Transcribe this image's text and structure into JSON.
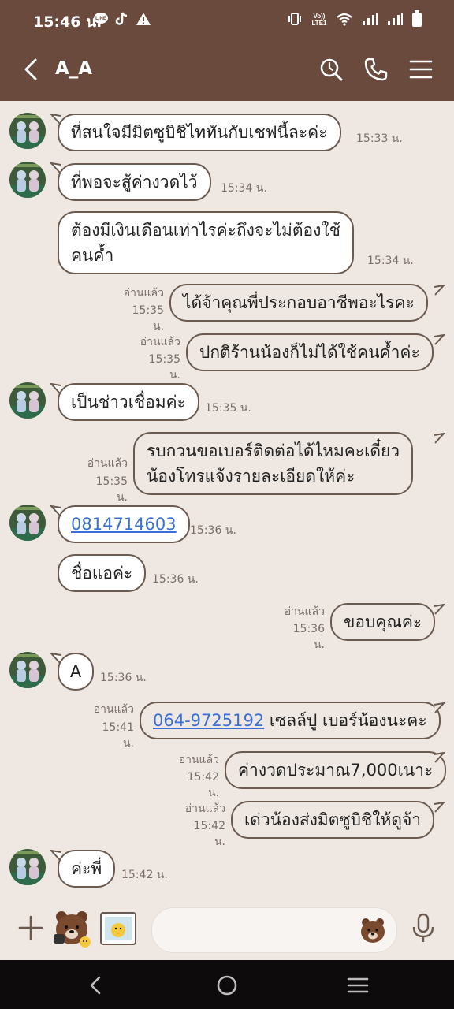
{
  "status_bar": {
    "time": "15:46 น.",
    "icons": [
      "line-notification-icon",
      "tiktok-icon",
      "warning-icon",
      "vibrate-icon",
      "volte-icon",
      "wifi-icon",
      "signal-icon",
      "signal-icon",
      "battery-icon"
    ]
  },
  "header": {
    "title": "A_A",
    "icons": [
      "back-icon",
      "search-icon",
      "phone-icon",
      "menu-icon"
    ]
  },
  "messages": [
    {
      "side": "in",
      "text": "ที่สนใจมีมิตซูบิชิไททันกับเชฟนี้ละค่ะ",
      "time": "15:33 น."
    },
    {
      "side": "in",
      "text": "ที่พอจะสู้ค่างวดไว้",
      "time": "15:34 น."
    },
    {
      "side": "in",
      "text": "ต้องมีเงินเดือนเท่าไรค่ะถึงจะไม่ต้องใช้คนค้ำ",
      "lines": [
        "ต้องมีเงินเดือนเท่าไรค่ะถึงจะไม่ต้องใช้",
        "คนค้ำ"
      ],
      "time": "15:34 น."
    },
    {
      "side": "out",
      "text": "ได้จ้าคุณพี่ประกอบอาชีพอะไรคะ",
      "read": "อ่านแล้ว",
      "time": "15:35 น."
    },
    {
      "side": "out",
      "text": "ปกติร้านน้องก็ไม่ได้ใช้คนค้ำค่ะ",
      "read": "อ่านแล้ว",
      "time": "15:35 น."
    },
    {
      "side": "in",
      "text": "เป็นช่าวเชื่อมค่ะ",
      "time": "15:35 น."
    },
    {
      "side": "out",
      "text": "รบกวนขอเบอร์ติดต่อได้ไหมคะเดี๋ยวน้องโทรแจ้งรายละเอียดให้ค่ะ",
      "lines": [
        "รบกวนขอเบอร์ติดต่อได้ไหมคะเดี๋ยว",
        "น้องโทรแจ้งรายละเอียดให้ค่ะ"
      ],
      "read": "อ่านแล้ว",
      "time": "15:35 น."
    },
    {
      "side": "in",
      "text": "0814714603",
      "is_link": true,
      "time": "15:36 น."
    },
    {
      "side": "in",
      "text": "ชื่อแอค่ะ",
      "time": "15:36 น."
    },
    {
      "side": "out",
      "text": "ขอบคุณค่ะ",
      "read": "อ่านแล้ว",
      "time": "15:36 น."
    },
    {
      "side": "in",
      "text": "A",
      "time": "15:36 น."
    },
    {
      "side": "out",
      "link": "064-9725192",
      "text": " เซลล์ปู เบอร์น้องนะคะ",
      "read": "อ่านแล้ว",
      "time": "15:41 น."
    },
    {
      "side": "out",
      "text": "ค่างวดประมาณ7,000เนาะ",
      "read": "อ่านแล้ว",
      "time": "15:42 น."
    },
    {
      "side": "out",
      "text": "เด่วน้องส่งมิตซูบิชิให้ดูจ้า",
      "read": "อ่านแล้ว",
      "time": "15:42 น."
    },
    {
      "side": "in",
      "text": "ค่ะพี่",
      "time": "15:42 น."
    }
  ],
  "composer": {
    "placeholder": "",
    "icons": [
      "plus-icon",
      "sticker-bear-icon",
      "photo-icon",
      "emoji-bear-icon",
      "microphone-icon"
    ]
  },
  "nav_bar": {
    "icons": [
      "back-nav-icon",
      "home-nav-icon",
      "recents-nav-icon"
    ]
  },
  "colors": {
    "header": "#6a4a3c",
    "chat_background": "#efe8e2",
    "bubble_border": "#6a5a50",
    "link": "#3a6fd6",
    "nav_bar": "#0d0b0b"
  }
}
